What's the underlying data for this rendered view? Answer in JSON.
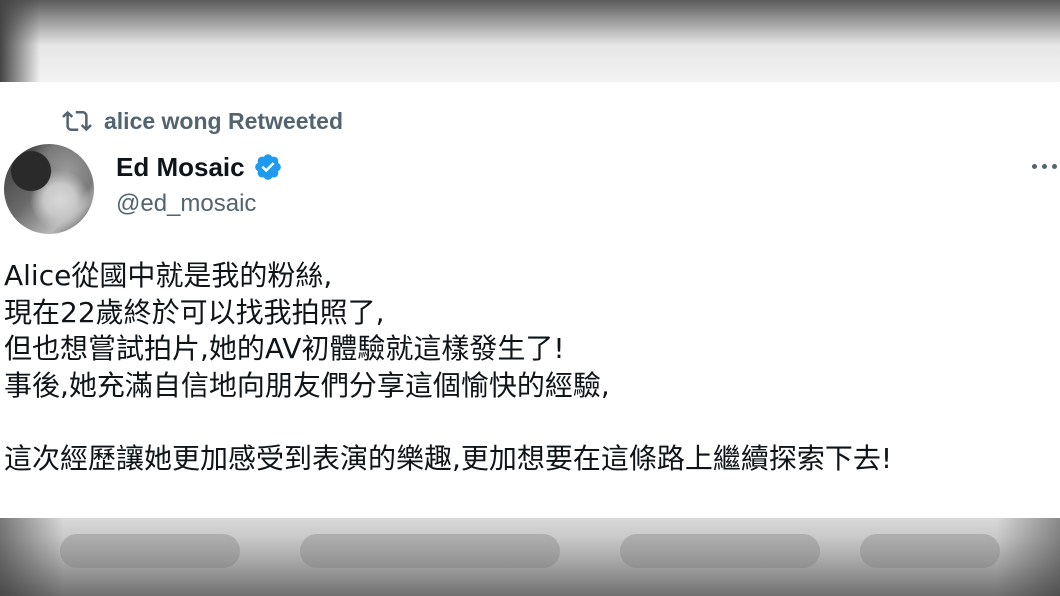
{
  "retweet": {
    "icon": "retweet-icon",
    "text": "alice wong Retweeted"
  },
  "author": {
    "display_name": "Ed Mosaic",
    "verified_icon": "verified-badge-icon",
    "handle": "@ed_mosaic",
    "avatar": "avatar"
  },
  "more_icon": "more-icon",
  "tweet": {
    "lines": [
      "Alice從國中就是我的粉絲,",
      "現在22歲終於可以找我拍照了,",
      "但也想嘗試拍片,她的AV初體驗就這樣發生了!",
      "事後,她充滿自信地向朋友們分享這個愉快的經驗,",
      "這次經歷讓她更加感受到表演的樂趣,更加想要在這條路上繼續探索下去!"
    ]
  },
  "colors": {
    "text": "#0f1419",
    "secondary": "#536471",
    "verified": "#1d9bf0",
    "card_bg": "#ffffff"
  }
}
